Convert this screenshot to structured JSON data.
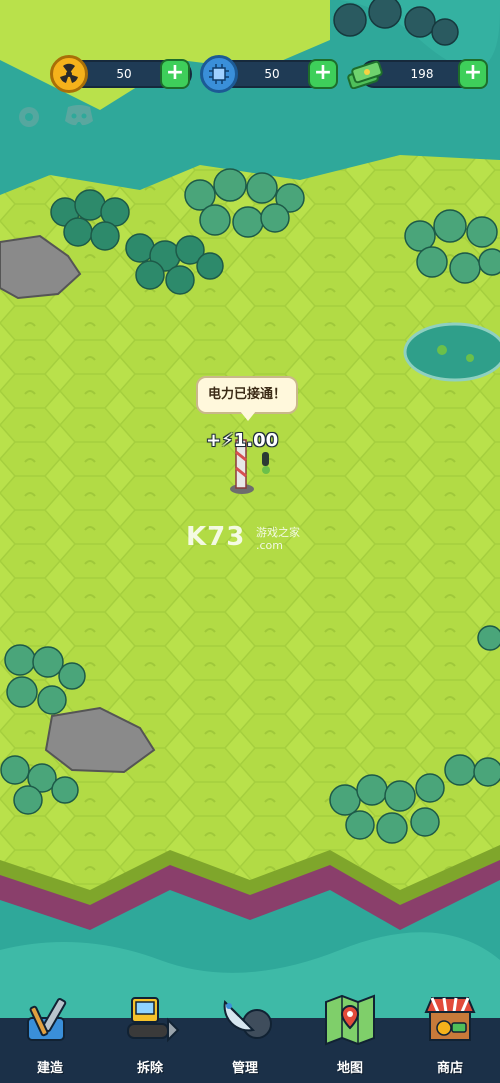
{
  "hud": {
    "radiation": {
      "value": "50",
      "icon": "radiation-icon",
      "color": "#f5b21b"
    },
    "chip": {
      "value": "50",
      "icon": "microchip-icon",
      "color": "#3a8fd9"
    },
    "cash": {
      "value": "198",
      "icon": "cash-stack-icon",
      "color": "#4fbf5a"
    },
    "add_label": "+"
  },
  "side_icons": [
    "settings-gear-icon",
    "discord-icon"
  ],
  "map": {
    "bubble_text": "电力已接通！",
    "gain_text": "+⚡1.00",
    "watermark_main": "K73",
    "watermark_sub1": "游戏之家",
    "watermark_sub2": ".com"
  },
  "nav": [
    {
      "label": "建造",
      "icon": "build-tools-icon"
    },
    {
      "label": "拆除",
      "icon": "bulldozer-icon"
    },
    {
      "label": "管理",
      "icon": "satellite-dish-icon"
    },
    {
      "label": "地图",
      "icon": "map-pin-icon"
    },
    {
      "label": "商店",
      "icon": "shop-stall-icon"
    }
  ],
  "colors": {
    "grass": "#b8e04a",
    "grass_dark": "#a3cf3c",
    "cliff": "#8a3f6b",
    "water": "#2fa89a",
    "nav_bg": "#1b3048"
  }
}
